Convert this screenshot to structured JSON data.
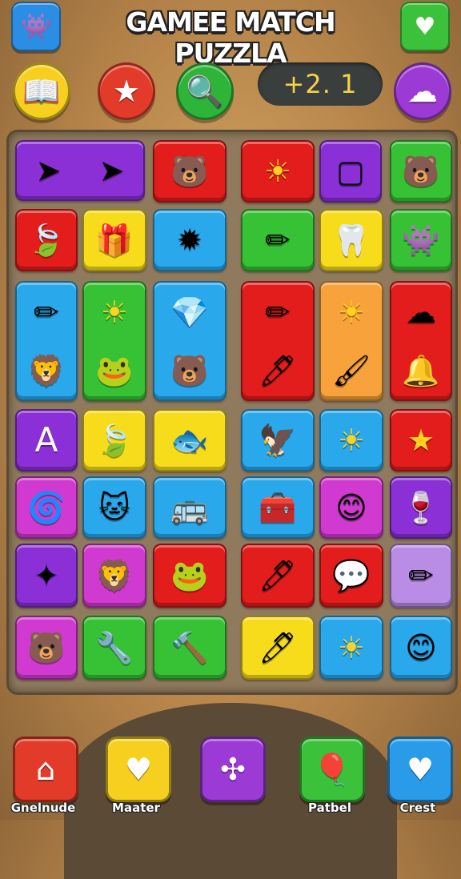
{
  "header": {
    "title": "GAMEE MATCH PUZZLA",
    "left_icon": "monster-icon",
    "right_icon": "heart-icon"
  },
  "toolbar": {
    "buttons": [
      {
        "name": "book-button",
        "icon": "book-icon",
        "glyph": "📖",
        "color": "#f6cf1f"
      },
      {
        "name": "star-button",
        "icon": "star-icon",
        "glyph": "★",
        "color": "#e23b2a"
      },
      {
        "name": "search-button",
        "icon": "magnifier-icon",
        "glyph": "🔍",
        "color": "#2fb43a"
      },
      {
        "name": "cloud-button",
        "icon": "cloud-icon",
        "glyph": "☁",
        "color": "#9c3ad6"
      }
    ],
    "score": "+2.   1"
  },
  "colors": {
    "purple": "#8b2fd6",
    "red": "#e31c1c",
    "yellow": "#f7dc1c",
    "blue": "#2aa8ec",
    "green": "#36c234",
    "orange": "#f7a23a",
    "pink": "#d13ad0",
    "lilac": "#b98ce6"
  },
  "board": {
    "tiles": [
      {
        "color": "#8b2fd6",
        "icons": [
          "➤",
          "➤"
        ],
        "names": [
          "arrow-icon",
          "arrow-icon"
        ]
      },
      {
        "color": "#e31c1c",
        "icons": [
          "🐻"
        ],
        "names": [
          "bear-icon"
        ]
      },
      {
        "color": "#e31c1c",
        "icons": [
          "☀"
        ],
        "names": [
          "sun-icon"
        ]
      },
      {
        "color": "#8b2fd6",
        "icons": [
          "▢"
        ],
        "names": [
          "mirror-icon"
        ]
      },
      {
        "color": "#36c234",
        "icons": [
          "🐻"
        ],
        "names": [
          "bear-face-icon"
        ]
      },
      {
        "color": "#e31c1c",
        "icons": [
          "🍃"
        ],
        "names": [
          "leaf-icon"
        ]
      },
      {
        "color": "#f7dc1c",
        "icons": [
          "🎁"
        ],
        "names": [
          "box-icon"
        ]
      },
      {
        "color": "#2aa8ec",
        "icons": [
          "✹"
        ],
        "names": [
          "flower-icon"
        ]
      },
      {
        "color": "#36c234",
        "icons": [
          "✏"
        ],
        "names": [
          "pencil-icon"
        ]
      },
      {
        "color": "#f7dc1c",
        "icons": [
          "🦷"
        ],
        "names": [
          "tooth-icon"
        ]
      },
      {
        "color": "#36c234",
        "icons": [
          "👾"
        ],
        "names": [
          "monster-icon"
        ]
      },
      {
        "color": "#2aa8ec",
        "icons": [
          "✏",
          "🦁"
        ],
        "names": [
          "pen-icon",
          "lion-icon"
        ]
      },
      {
        "color": "#36c234",
        "icons": [
          "☀",
          "🐸"
        ],
        "names": [
          "sun-icon",
          "robot-icon"
        ]
      },
      {
        "color": "#2aa8ec",
        "icons": [
          "💎",
          "🐻"
        ],
        "names": [
          "gem-icon",
          "bear-icon"
        ]
      },
      {
        "color": "#e31c1c",
        "icons": [
          "✏",
          "🖊"
        ],
        "names": [
          "pencil-icon",
          "pen-icon"
        ]
      },
      {
        "color": "#f7a23a",
        "icons": [
          "☀",
          "🖌"
        ],
        "names": [
          "sun-icon",
          "brush-icon"
        ]
      },
      {
        "color": "#e31c1c",
        "icons": [
          "☁",
          "🔔"
        ],
        "names": [
          "cloud-icon",
          "bell-icon"
        ]
      },
      {
        "color": "#8b2fd6",
        "icons": [
          "A"
        ],
        "names": [
          "compass-icon"
        ]
      },
      {
        "color": "#f7dc1c",
        "icons": [
          "🍃"
        ],
        "names": [
          "leaf-icon"
        ]
      },
      {
        "color": "#f7dc1c",
        "icons": [
          "🐟"
        ],
        "names": [
          "fish-icon"
        ]
      },
      {
        "color": "#2aa8ec",
        "icons": [
          "🦅"
        ],
        "names": [
          "bird-icon"
        ]
      },
      {
        "color": "#2aa8ec",
        "icons": [
          "☀"
        ],
        "names": [
          "sun-icon"
        ]
      },
      {
        "color": "#e31c1c",
        "icons": [
          "★"
        ],
        "names": [
          "star-icon"
        ]
      },
      {
        "color": "#d13ad0",
        "icons": [
          "🌀"
        ],
        "names": [
          "spiral-icon"
        ]
      },
      {
        "color": "#2aa8ec",
        "icons": [
          "🐱"
        ],
        "names": [
          "cat-icon"
        ]
      },
      {
        "color": "#2aa8ec",
        "icons": [
          "🚌"
        ],
        "names": [
          "bus-icon"
        ]
      },
      {
        "color": "#2aa8ec",
        "icons": [
          "🧰"
        ],
        "names": [
          "bag-icon"
        ]
      },
      {
        "color": "#d13ad0",
        "icons": [
          "😊"
        ],
        "names": [
          "face-icon"
        ]
      },
      {
        "color": "#8b2fd6",
        "icons": [
          "🍷"
        ],
        "names": [
          "glass-icon"
        ]
      },
      {
        "color": "#8b2fd6",
        "icons": [
          "✦"
        ],
        "names": [
          "shuriken-icon"
        ]
      },
      {
        "color": "#d13ad0",
        "icons": [
          "🦁"
        ],
        "names": [
          "lion-icon"
        ]
      },
      {
        "color": "#e31c1c",
        "icons": [
          "🐸"
        ],
        "names": [
          "frog-icon"
        ]
      },
      {
        "color": "#e31c1c",
        "icons": [
          "🖊"
        ],
        "names": [
          "pen-icon"
        ]
      },
      {
        "color": "#e31c1c",
        "icons": [
          "💬"
        ],
        "names": [
          "bubble-icon"
        ]
      },
      {
        "color": "#b98ce6",
        "icons": [
          "✏"
        ],
        "names": [
          "pencil-icon"
        ]
      },
      {
        "color": "#d13ad0",
        "icons": [
          "🐻"
        ],
        "names": [
          "bear-icon"
        ]
      },
      {
        "color": "#36c234",
        "icons": [
          "🔧"
        ],
        "names": [
          "wrench-icon"
        ]
      },
      {
        "color": "#36c234",
        "icons": [
          "🔨"
        ],
        "names": [
          "hammer-icon"
        ]
      },
      {
        "color": "#f7dc1c",
        "icons": [
          "🖊"
        ],
        "names": [
          "pen-icon"
        ]
      },
      {
        "color": "#2aa8ec",
        "icons": [
          "☀"
        ],
        "names": [
          "sun-icon"
        ]
      },
      {
        "color": "#2aa8ec",
        "icons": [
          "😊"
        ],
        "names": [
          "face-icon"
        ]
      }
    ]
  },
  "bottom_nav": [
    {
      "label": "Gnelnude",
      "icon": "house-icon",
      "glyph": "⌂",
      "color": "#e23b2a"
    },
    {
      "label": "Maater",
      "icon": "heart-icon",
      "glyph": "♥",
      "color": "#f6cf1f"
    },
    {
      "label": "",
      "icon": "nodes-icon",
      "glyph": "✣",
      "color": "#9c3ad6"
    },
    {
      "label": "Patbel",
      "icon": "balloon-icon",
      "glyph": "🎈",
      "color": "#3cc23a"
    },
    {
      "label": "Crest",
      "icon": "heart-icon",
      "glyph": "♥",
      "color": "#2a9be8"
    }
  ]
}
